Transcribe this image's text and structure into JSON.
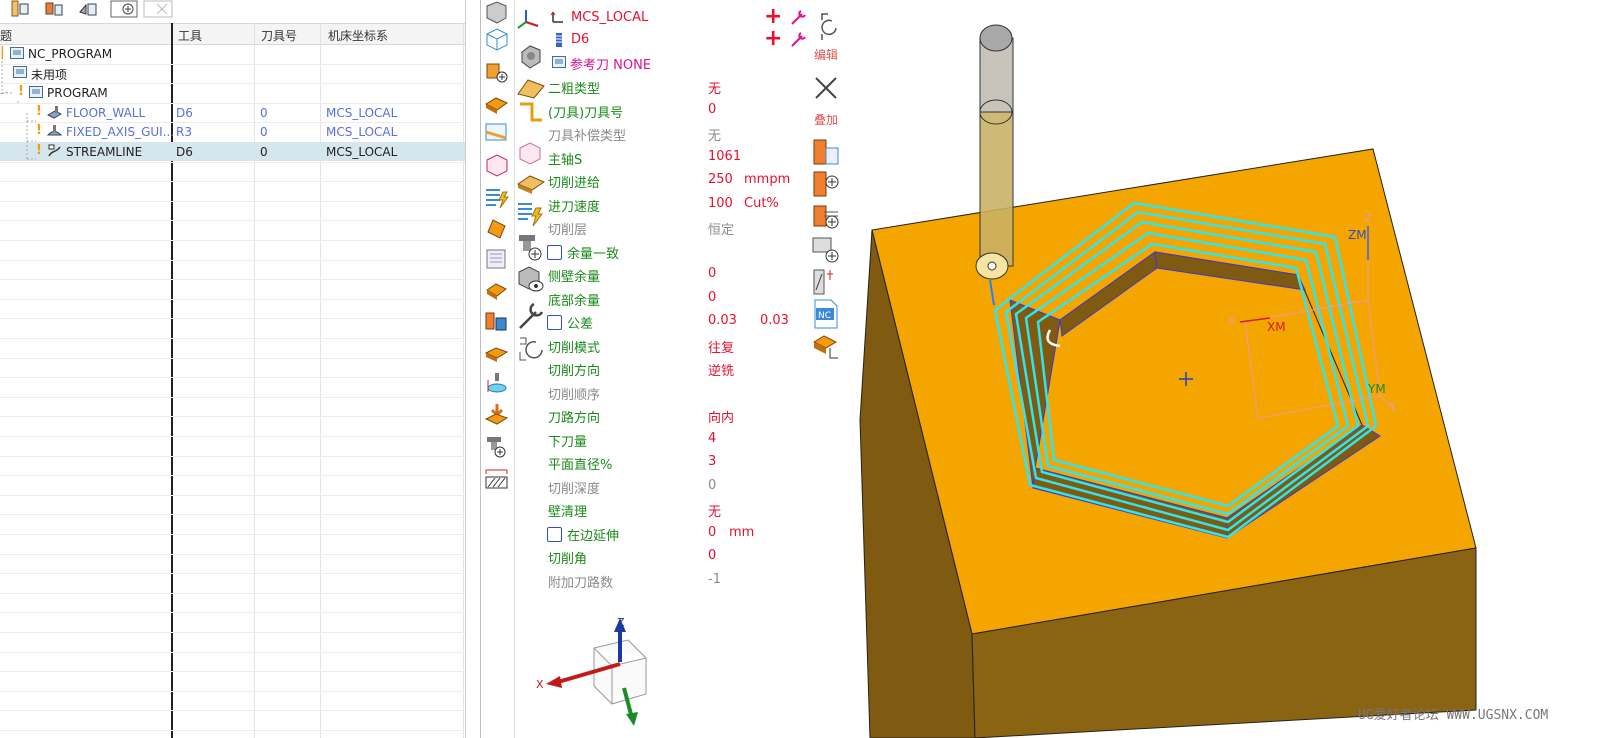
{
  "navigator": {
    "columns": [
      "工具",
      "刀具号",
      "机床坐标系"
    ],
    "first_column_partial": "题",
    "rows": [
      {
        "name": "NC_PROGRAM",
        "tool": "",
        "tool_no": "",
        "mcs": ""
      },
      {
        "name": "未用项",
        "tool": "",
        "tool_no": "",
        "mcs": ""
      },
      {
        "name": "PROGRAM",
        "tool": "",
        "tool_no": "",
        "mcs": ""
      },
      {
        "name": "FLOOR_WALL",
        "tool": "D6",
        "tool_no": "0",
        "mcs": "MCS_LOCAL"
      },
      {
        "name": "FIXED_AXIS_GUI...",
        "tool": "R3",
        "tool_no": "0",
        "mcs": "MCS_LOCAL"
      },
      {
        "name": "STREAMLINE",
        "tool": "D6",
        "tool_no": "0",
        "mcs": "MCS_LOCAL"
      }
    ]
  },
  "panel": {
    "mcs": "MCS_LOCAL",
    "tool": "D6",
    "ref_tool": "参考刀 NONE",
    "edit_label": "编辑",
    "stack_label": "叠加",
    "params": [
      {
        "label": "二粗类型",
        "value": "无",
        "unit": "",
        "value2": "",
        "color": "green",
        "vcolor": "red",
        "checkbox": false
      },
      {
        "label": "(刀具)刀具号",
        "value": "0",
        "unit": "",
        "value2": "",
        "color": "green",
        "vcolor": "red",
        "checkbox": false
      },
      {
        "label": "刀具补偿类型",
        "value": "无",
        "unit": "",
        "value2": "",
        "color": "gray",
        "vcolor": "gray",
        "checkbox": false
      },
      {
        "label": "主轴S",
        "value": "1061",
        "unit": "",
        "value2": "",
        "color": "green",
        "vcolor": "red",
        "checkbox": false
      },
      {
        "label": "切削进给",
        "value": "250",
        "unit": "mmpm",
        "value2": "",
        "color": "green",
        "vcolor": "red",
        "checkbox": false
      },
      {
        "label": "进刀速度",
        "value": "100",
        "unit": "Cut%",
        "value2": "",
        "color": "green",
        "vcolor": "red",
        "checkbox": false
      },
      {
        "label": "切削层",
        "value": "恒定",
        "unit": "",
        "value2": "",
        "color": "gray",
        "vcolor": "gray",
        "checkbox": false
      },
      {
        "label": "余量一致",
        "value": "",
        "unit": "",
        "value2": "",
        "color": "green",
        "vcolor": "red",
        "checkbox": true
      },
      {
        "label": "侧壁余量",
        "value": "0",
        "unit": "",
        "value2": "",
        "color": "green",
        "vcolor": "red",
        "checkbox": false
      },
      {
        "label": "底部余量",
        "value": "0",
        "unit": "",
        "value2": "",
        "color": "green",
        "vcolor": "red",
        "checkbox": false
      },
      {
        "label": "公差",
        "value": "0.03",
        "unit": "",
        "value2": "0.03",
        "color": "green",
        "vcolor": "red",
        "checkbox": true
      },
      {
        "label": "切削模式",
        "value": "往复",
        "unit": "",
        "value2": "",
        "color": "green",
        "vcolor": "red",
        "checkbox": false
      },
      {
        "label": "切削方向",
        "value": "逆铣",
        "unit": "",
        "value2": "",
        "color": "green",
        "vcolor": "red",
        "checkbox": false
      },
      {
        "label": "切削顺序",
        "value": "",
        "unit": "",
        "value2": "",
        "color": "gray",
        "vcolor": "gray",
        "checkbox": false
      },
      {
        "label": "刀路方向",
        "value": "向内",
        "unit": "",
        "value2": "",
        "color": "green",
        "vcolor": "red",
        "checkbox": false
      },
      {
        "label": "下刀量",
        "value": "4",
        "unit": "",
        "value2": "",
        "color": "green",
        "vcolor": "red",
        "checkbox": false
      },
      {
        "label": "平面直径%",
        "value": "3",
        "unit": "",
        "value2": "",
        "color": "green",
        "vcolor": "red",
        "checkbox": false
      },
      {
        "label": "切削深度",
        "value": "0",
        "unit": "",
        "value2": "",
        "color": "gray",
        "vcolor": "gray",
        "checkbox": false
      },
      {
        "label": "壁清理",
        "value": "无",
        "unit": "",
        "value2": "",
        "color": "green",
        "vcolor": "red",
        "checkbox": false
      },
      {
        "label": "在边延伸",
        "value": "0",
        "unit": "mm",
        "value2": "",
        "color": "green",
        "vcolor": "red",
        "checkbox": true
      },
      {
        "label": "切削角",
        "value": "0",
        "unit": "",
        "value2": "",
        "color": "green",
        "vcolor": "red",
        "checkbox": false
      },
      {
        "label": "附加刀路数",
        "value": "-1",
        "unit": "",
        "value2": "",
        "color": "gray",
        "vcolor": "gray",
        "checkbox": false
      }
    ]
  },
  "triad": {
    "x": "X",
    "z": "Z"
  },
  "viewport": {
    "zm": "ZM",
    "xm": "XM",
    "ym": "YM",
    "x": "X",
    "y": "Y",
    "z": "Z",
    "watermark": "UG爱好者论坛 WWW.UGSNX.COM"
  },
  "colors": {
    "block_top": "#F5A500",
    "block_side": "#7F5A10",
    "toolpath": "#2EE6F0",
    "label_green": "#1A8A1A",
    "value_red": "#E8102E"
  }
}
